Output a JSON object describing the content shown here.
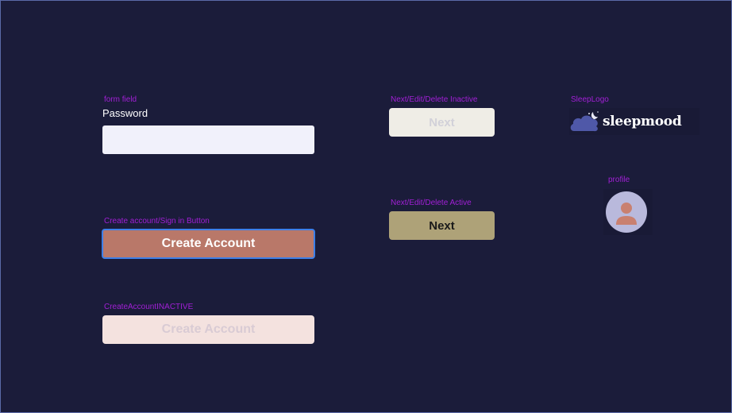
{
  "captions": {
    "form_field": "form field",
    "create_button": "Create account/Sign in Button",
    "create_inactive": "CreateAccountINACTIVE",
    "next_inactive": "Next/Edit/Delete Inactive",
    "next_active": "Next/Edit/Delete Active",
    "logo": "SleepLogo",
    "profile": "profile"
  },
  "form": {
    "password_label": "Password",
    "password_value": ""
  },
  "buttons": {
    "create_account": "Create Account",
    "create_account_inactive": "Create Account",
    "next_inactive": "Next",
    "next_active": "Next"
  },
  "logo": {
    "text": "sleepmood",
    "icon": "cloud-moon-icon"
  },
  "profile": {
    "icon": "user-icon"
  },
  "colors": {
    "background": "#1b1c3a",
    "caption": "#a21fd6",
    "create_button": "#b97869",
    "create_inactive": "#f4e2df",
    "next_inactive": "#efede6",
    "next_active": "#aea278",
    "focus_border": "#3d7fe8"
  }
}
